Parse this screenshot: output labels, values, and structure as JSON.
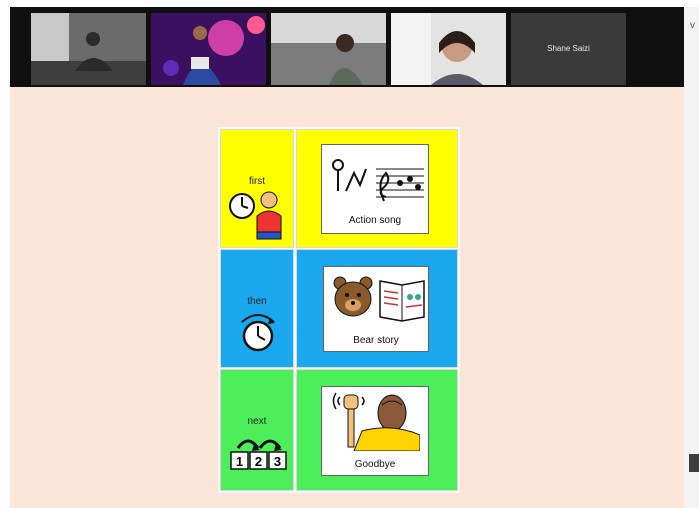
{
  "meeting": {
    "participants": [
      {
        "id": "p1",
        "type": "video"
      },
      {
        "id": "p2",
        "type": "video"
      },
      {
        "id": "p3",
        "type": "video"
      },
      {
        "id": "p4",
        "type": "video"
      },
      {
        "id": "p5",
        "type": "name",
        "name": "Shane Saizi"
      }
    ]
  },
  "schedule": {
    "rows": [
      {
        "step": "first",
        "activity": "Action song",
        "step_color": "#ffff00",
        "activity_color": "#ffff00",
        "step_icon": "clock-person-icon",
        "activity_icon": "music-actions-icon"
      },
      {
        "step": "then",
        "activity": "Bear story",
        "step_color": "#1aa9ef",
        "activity_color": "#1aa9ef",
        "step_icon": "timer-icon",
        "activity_icon": "bear-book-icon"
      },
      {
        "step": "next",
        "activity": "Goodbye",
        "step_color": "#4cef5a",
        "activity_color": "#4cef5a",
        "step_icon": "sequence-123-icon",
        "activity_icon": "waving-person-icon"
      }
    ]
  },
  "ui": {
    "scroll_chevron": "v"
  }
}
